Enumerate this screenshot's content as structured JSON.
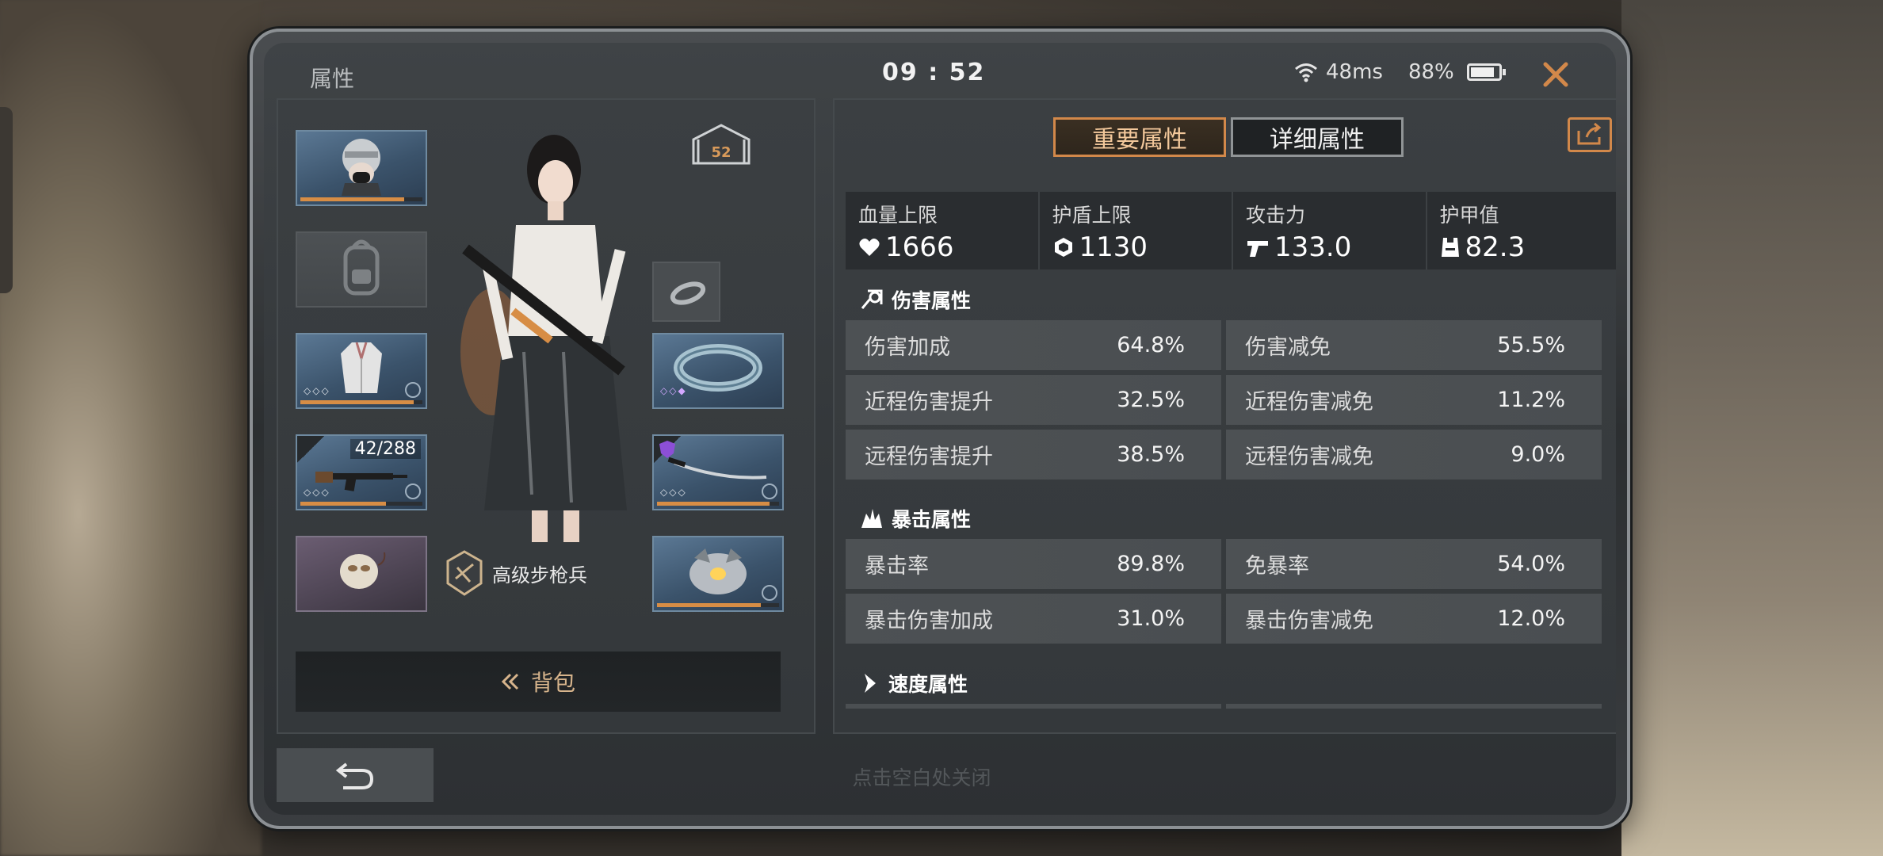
{
  "header": {
    "title": "属性",
    "time": "09 : 52",
    "ping": "48ms",
    "battery_percent": "88%",
    "battery_level": 0.88
  },
  "left": {
    "level": "52",
    "weapon_ammo": "42/288",
    "rank_title": "高级步枪兵",
    "backpack_label": "背包",
    "slots": [
      {
        "name": "helmet",
        "durability": 0.85
      },
      {
        "name": "backpack",
        "durability": null
      },
      {
        "name": "armor",
        "durability": 0.93
      },
      {
        "name": "rifle",
        "durability": 0.7
      },
      {
        "name": "mask",
        "durability": null
      },
      {
        "name": "ring",
        "durability": null
      },
      {
        "name": "bracelet",
        "durability": null
      },
      {
        "name": "blade",
        "durability": 0.92
      },
      {
        "name": "pet",
        "durability": 0.85
      }
    ]
  },
  "tabs": {
    "important": "重要属性",
    "detailed": "详细属性"
  },
  "summary": [
    {
      "label": "血量上限",
      "value": "1666",
      "icon": "heart-icon"
    },
    {
      "label": "护盾上限",
      "value": "1130",
      "icon": "shield-icon"
    },
    {
      "label": "攻击力",
      "value": "133.0",
      "icon": "gun-icon"
    },
    {
      "label": "护甲值",
      "value": "82.3",
      "icon": "vest-icon"
    }
  ],
  "sections": {
    "damage": {
      "title": "伤害属性",
      "stats": [
        {
          "label": "伤害加成",
          "value": "64.8%"
        },
        {
          "label": "伤害减免",
          "value": "55.5%"
        },
        {
          "label": "近程伤害提升",
          "value": "32.5%"
        },
        {
          "label": "近程伤害减免",
          "value": "11.2%"
        },
        {
          "label": "远程伤害提升",
          "value": "38.5%"
        },
        {
          "label": "远程伤害减免",
          "value": "9.0%"
        }
      ]
    },
    "crit": {
      "title": "暴击属性",
      "stats": [
        {
          "label": "暴击率",
          "value": "89.8%"
        },
        {
          "label": "免暴率",
          "value": "54.0%"
        },
        {
          "label": "暴击伤害加成",
          "value": "31.0%"
        },
        {
          "label": "暴击伤害减免",
          "value": "12.0%"
        }
      ]
    },
    "speed": {
      "title": "速度属性"
    }
  },
  "footer": {
    "hint": "点击空白处关闭"
  },
  "colors": {
    "accent": "#d2884a",
    "durability": "#d78d45"
  }
}
